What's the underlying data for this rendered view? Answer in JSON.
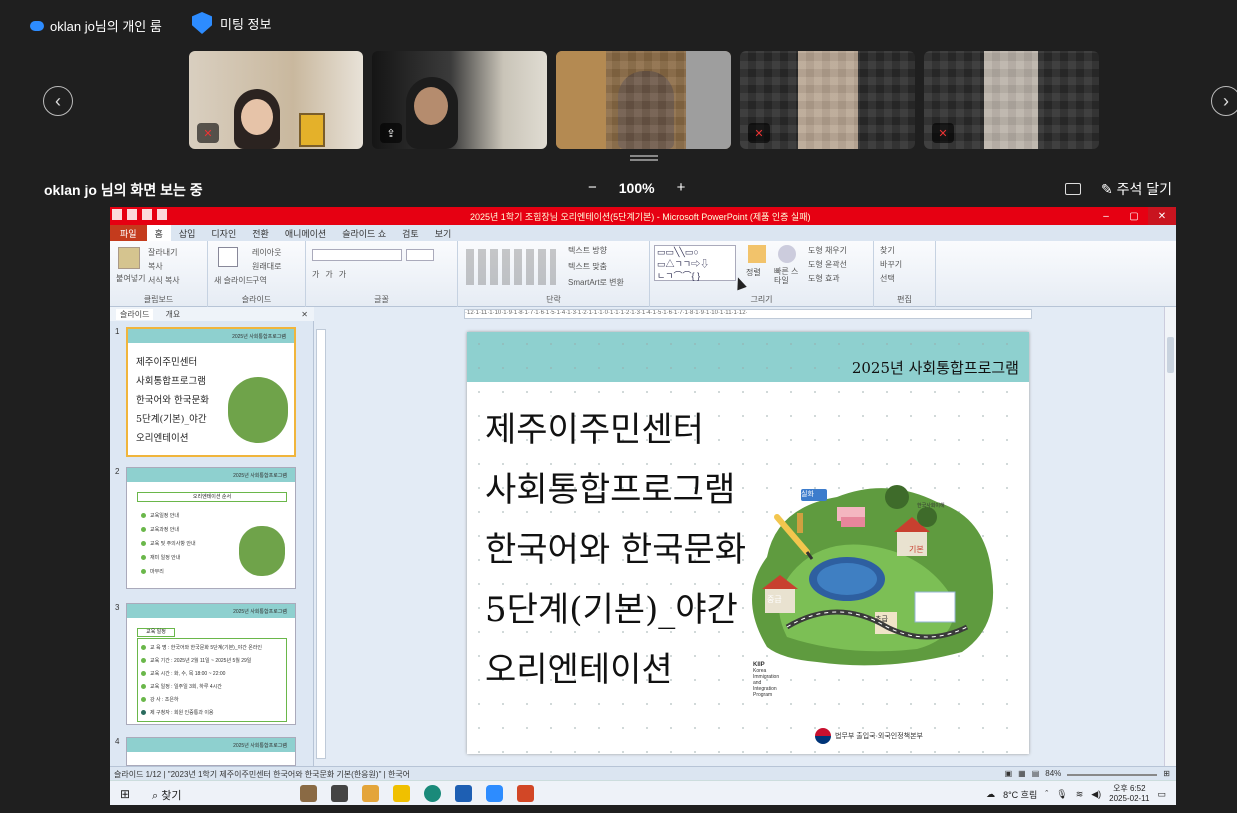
{
  "zoom": {
    "window_title": "oklan jo님의 개인 룸",
    "meeting_info": "미팅 정보",
    "viewing_label": "oklan jo 님의 화면 보는 중",
    "zoom_minus": "−",
    "zoom_level": "100%",
    "zoom_plus": "+",
    "annotate_label": "주석 달기",
    "nav_prev": "‹",
    "nav_next": "›"
  },
  "colors": {
    "accent": "#2d8cff",
    "ppt_red": "#e60012",
    "slide_band": "#8ed0cf",
    "mute": "#e33333"
  },
  "participants": [
    {
      "name": "participant-1",
      "muted": true,
      "icon": "mic-muted-icon"
    },
    {
      "name": "participant-2",
      "muted": false,
      "icon": "share-screen-icon"
    },
    {
      "name": "participant-3",
      "muted": false,
      "icon": ""
    },
    {
      "name": "participant-4",
      "muted": true,
      "icon": "mic-muted-icon"
    },
    {
      "name": "participant-5",
      "muted": true,
      "icon": "mic-muted-icon"
    }
  ],
  "ppt": {
    "title_bar": "2025년 1학기 조힘장님 오리엔테이션(5단계기본) - Microsoft PowerPoint (제품 인증 실패)",
    "tabs": [
      "파일",
      "홈",
      "삽입",
      "디자인",
      "전환",
      "애니메이션",
      "슬라이드 쇼",
      "검토",
      "보기"
    ],
    "ribbon": {
      "clipboard": {
        "label": "클립보드",
        "paste": "붙여넣기",
        "cut": "잘라내기",
        "copy": "복사",
        "format": "서식 복사"
      },
      "slides": {
        "label": "슬라이드",
        "new": "새 슬라이드",
        "layout": "레이아웃",
        "reset": "원래대로",
        "section": "구역"
      },
      "font": {
        "label": "글꼴"
      },
      "paragraph": {
        "label": "단락",
        "dir": "텍스트 방향",
        "align": "텍스트 맞춤",
        "smartart": "SmartArt로 변환"
      },
      "drawing": {
        "label": "그리기",
        "arrange": "정렬",
        "quick": "빠른 스타일",
        "fill": "도형 채우기",
        "outline": "도형 윤곽선",
        "effect": "도형 효과"
      },
      "editing": {
        "label": "편집",
        "find": "찾기",
        "replace": "바꾸기",
        "select": "선택"
      }
    },
    "panel_tabs": [
      "슬라이드",
      "개요"
    ],
    "ruler_text": "·12·1·11·1·10·1·9·1·8·1·7·1·6·1·5·1·4·1·3·1·2·1·1·1·0·1·1·1·2·1·3·1·4·1·5·1·6·1·7·1·8·1·9·1·10·1·11·1·12·",
    "thumbs": [
      {
        "num": "1",
        "header": "2025년 사회통합프로그램",
        "lines": [
          "제주이주민센터",
          "사회통합프로그램",
          "한국어와 한국문화",
          "5단계(기본)_야간",
          "오리엔테이션"
        ]
      },
      {
        "num": "2",
        "header": "2025년 사회통합프로그램",
        "box": "오리엔테이션 순서",
        "items": [
          "교육일정 안내",
          "교육과정 안내",
          "교육 및 주의사항 안내",
          "재미 일정 안내",
          "마무리"
        ]
      },
      {
        "num": "3",
        "header": "2025년 사회통합프로그램",
        "box": "교육 일정",
        "items": [
          "교 육 명 : 한국어와 한국문화 5단계(기본)_야간 온라인",
          "교육 기간 : 2025년 2월 11일 ~ 2025년 5월 29일",
          "교육 시간 : 화, 수, 목 18:00 ~ 22:00",
          "교육 일정 : 일주일 3회, 하루 4시간",
          "강  사 : 조은하",
          "제 구청자 : 회원 인증통과 이용"
        ]
      },
      {
        "num": "4",
        "header": "2025년 사회통합프로그램"
      }
    ],
    "slide": {
      "header": "2025년 사회통합프로그램",
      "lines": [
        "제주이주민센터",
        "사회통합프로그램",
        "한국어와 한국문화",
        "5단계(기본)_야간",
        "오리엔테이션"
      ],
      "kiip": [
        "KIIP",
        "Korea",
        "Immigration",
        "and",
        "Integration",
        "Program"
      ],
      "ministry": "법무부 출입국·외국인정책본부",
      "badges": {
        "real": "실화",
        "basic": "기본",
        "middle": "중급",
        "elem": "초급",
        "culture": "한국사회이해"
      }
    },
    "status": {
      "slide_num": "슬라이드 1/12",
      "theme": "\"2023년 1학기 제주이주민센터 한국어와 한국문화 기본(한응원)\"",
      "lang": "한국어",
      "zoom": "84%"
    },
    "taskbar": {
      "search": "찾기",
      "weather": "8°C 흐림",
      "time": "오후 6:52",
      "date": "2025-02-11"
    }
  }
}
